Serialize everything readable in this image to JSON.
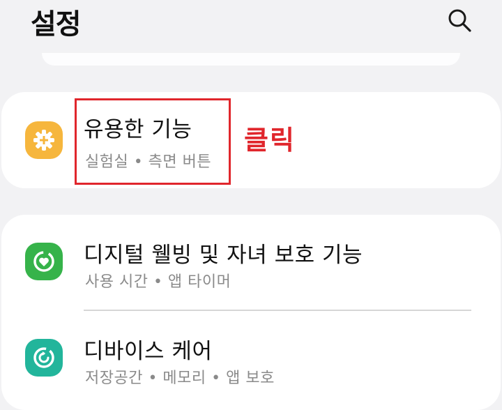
{
  "header": {
    "title": "설정",
    "search_icon": "search-icon"
  },
  "items": [
    {
      "title": "유용한 기능",
      "subtitle": "실험실 • 측면 버튼",
      "icon": "plus-gear-icon",
      "icon_color": "#f6b63d"
    },
    {
      "title": "디지털 웰빙 및 자녀 보호 기능",
      "subtitle": "사용 시간 • 앱 타이머",
      "icon": "heart-circle-icon",
      "icon_color": "#36b34a"
    },
    {
      "title": "디바이스 케어",
      "subtitle": "저장공간 • 메모리 • 앱 보호",
      "icon": "refresh-circle-icon",
      "icon_color": "#22b59b"
    }
  ],
  "annotation": {
    "text": "클릭",
    "color": "#e0262c"
  }
}
